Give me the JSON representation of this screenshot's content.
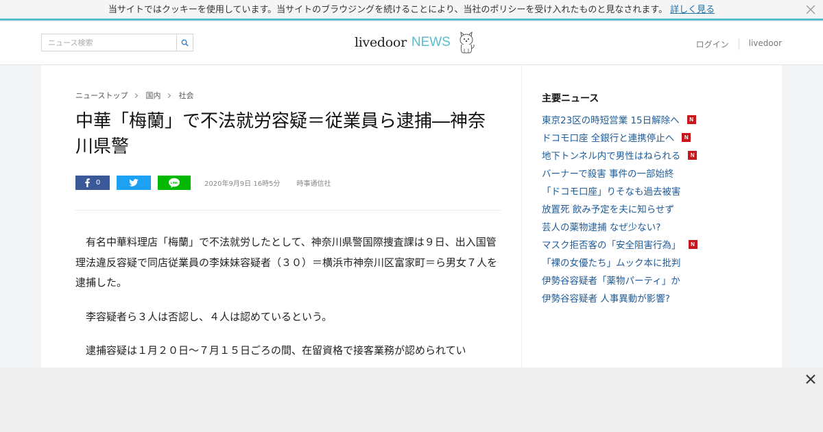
{
  "cookie": {
    "message": "当サイトではクッキーを使用しています。当サイトのブラウジングを続けることにより、当社のポリシーを受け入れたものと見なされます。",
    "link": "詳しく見る"
  },
  "header": {
    "search_placeholder": "ニュース検索",
    "logo_main": "livedoor",
    "logo_sub": "NEWS",
    "links": [
      "ログイン",
      "livedoor"
    ]
  },
  "article": {
    "breadcrumb": [
      "ニューストップ",
      "国内",
      "社会"
    ],
    "title": "中華「梅蘭」で不法就労容疑＝従業員ら逮捕―神奈川県警",
    "facebook_count": "0",
    "date": "2020年9月9日 16時5分",
    "source": "時事通信社",
    "paragraphs": [
      "有名中華料理店「梅蘭」で不法就労したとして、神奈川県警国際捜査課は９日、出入国管理法違反容疑で同店従業員の李妹妹容疑者（３０）＝横浜市神奈川区富家町＝ら男女７人を逮捕した。",
      "李容疑者ら３人は否認し、４人は認めているという。",
      "逮捕容疑は１月２０日～７月１５日ごろの間、在留資格で接客業務が認められてい"
    ]
  },
  "sidebar": {
    "title": "主要ニュース",
    "items": [
      {
        "text": "東京23区の時短営業 15日解除へ",
        "new": true
      },
      {
        "text": "ドコモ口座 全銀行と連携停止へ",
        "new": true
      },
      {
        "text": "地下トンネル内で男性はねられる",
        "new": true
      },
      {
        "text": "バーナーで殺害 事件の一部始終",
        "new": false
      },
      {
        "text": "「ドコモ口座」りそなも過去被害",
        "new": false
      },
      {
        "text": "放置死 飲み予定を夫に知らせず",
        "new": false
      },
      {
        "text": "芸人の薬物逮捕 なぜ少ない?",
        "new": false
      },
      {
        "text": "マスク拒否客の「安全阻害行為」",
        "new": true
      },
      {
        "text": "「裸の女優たち」ムック本に批判",
        "new": false
      },
      {
        "text": "伊勢谷容疑者「薬物パーティ」か",
        "new": false
      },
      {
        "text": "伊勢谷容疑者 人事異動が影響?",
        "new": false
      }
    ],
    "new_badge": "N"
  },
  "colors": {
    "accent": "#5bbccc",
    "link": "#1f5c99",
    "facebook": "#3b5998",
    "twitter": "#1da1f2",
    "line": "#00b900",
    "new_badge": "#c8161d"
  }
}
